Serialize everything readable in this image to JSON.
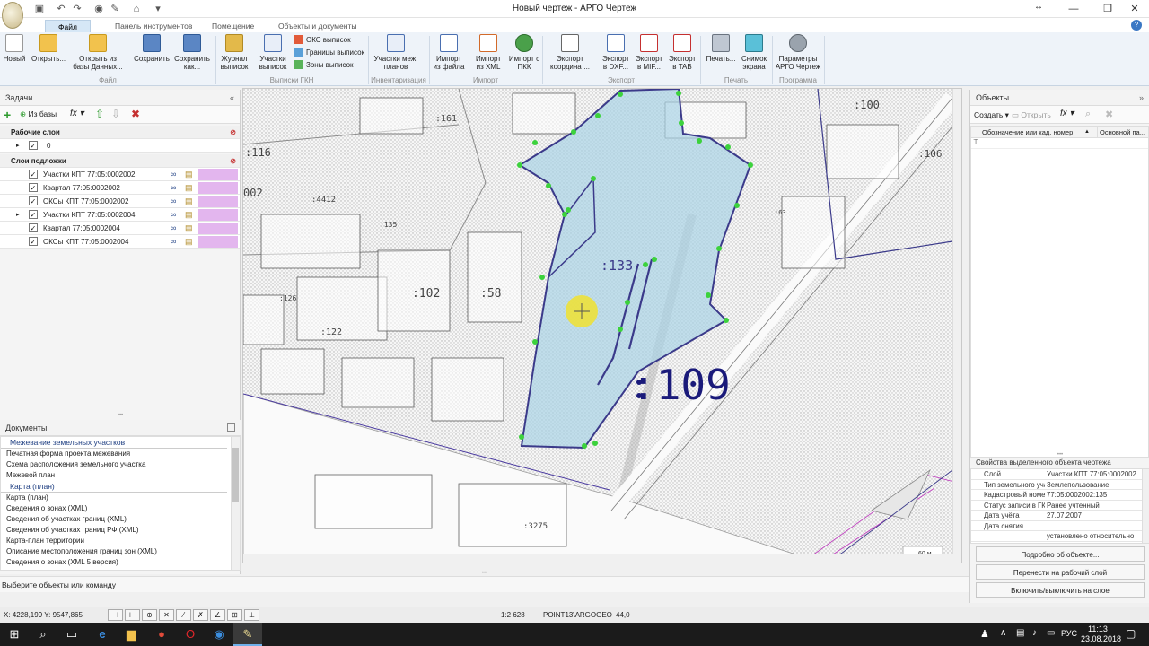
{
  "window": {
    "title": "Новый чертеж - АРГО Чертеж",
    "controls": [
      "—",
      "❐",
      "✕"
    ]
  },
  "tabs": [
    "Файл",
    "Панель инструментов",
    "Помещение",
    "Объекты и документы"
  ],
  "ribbon": {
    "buttons": {
      "new": "Новый",
      "open": "Открыть...",
      "open_db": "Открыть из базы Данных...",
      "save": "Сохранить",
      "save_as": "Сохранить как...",
      "journal": "Журнал выписок",
      "parcels": "Участки выписок",
      "oks": "ОКС выписок",
      "borders": "Границы выписок",
      "zones": "Зоны выписок",
      "inter_parcels": "Участки меж. планов",
      "import_file": "Импорт из файла",
      "import_xml": "Импорт из XML",
      "import_pkk": "Импорт с ПКК",
      "export_coords": "Экспорт координат...",
      "export_dxf": "Экспорт в DXF...",
      "export_mif": "Экспорт в MIF...",
      "export_tab": "Экспорт в TAB",
      "print": "Печать...",
      "snapshot": "Снимок экрана",
      "params": "Параметры АРГО Чертеж"
    },
    "groups": {
      "file": "Файл",
      "gkn": "Выписки ГКН",
      "inv": "Инвентаризация",
      "import": "Импорт",
      "export": "Экспорт",
      "print": "Печать",
      "program": "Программа"
    }
  },
  "tasks": {
    "title": "Задачи",
    "from_db": "Из базы",
    "fx": "fx",
    "working_layers": "Рабочие слои",
    "working_items": [
      "0"
    ],
    "base_layers": "Слои подложки",
    "base_items": [
      "Участки КПТ 77:05:0002002",
      "Квартал 77:05:0002002",
      "ОКСы КПТ 77:05:0002002",
      "Участки КПТ 77:05:0002004",
      "Квартал 77:05:0002004",
      "ОКСы КПТ 77:05:0002004"
    ]
  },
  "documents": {
    "title": "Документы",
    "section1": "Межевание земельных участков",
    "items1": [
      "Печатная форма проекта межевания",
      "Схема расположения земельного участка",
      "Межевой план"
    ],
    "section2": "Карта (план)",
    "items2": [
      "Карта (план)",
      "Сведения о зонах (XML)",
      "Сведения об участках границ (XML)",
      "Сведения об участках границ РФ (XML)",
      "Карта-план территории",
      "Описание местоположения границ зон (XML)",
      "Сведения о зонах (XML 5 версия)"
    ]
  },
  "map": {
    "labels": [
      ":161",
      ":116",
      "002",
      ":4412",
      ":135",
      ":126",
      ":102",
      ":58",
      ":122",
      ":133",
      ":63",
      ":109",
      ":3275",
      ":100",
      ":106"
    ],
    "scale": "60 м",
    "colors": {
      "selection": "#a9d3e6",
      "boundary": "#3b3a8a",
      "vertex": "#3cd23c",
      "hatch": "#bdbdbd",
      "cursor": "#f0e230"
    }
  },
  "objects": {
    "title": "Объекты",
    "create": "Создать",
    "open": "Открыть",
    "col1": "Обозначение или кад. номер",
    "col2": "Основной па..."
  },
  "properties": {
    "title": "Свойства выделенного объекта чертежа",
    "rows": [
      {
        "k": "Слой",
        "v": "Участки КПТ 77:05:0002002"
      },
      {
        "k": "Тип земельного уча",
        "v": "Землепользование"
      },
      {
        "k": "Кадастровый номер",
        "v": "77:05:0002002:135"
      },
      {
        "k": "Статус записи в ГК",
        "v": "Ранее учтенный"
      },
      {
        "k": "Дата учёта",
        "v": "27.07.2007"
      },
      {
        "k": "Дата снятия",
        "v": ""
      },
      {
        "k": "",
        "v": "установлено относительно ориентира"
      }
    ],
    "btn_details": "Подробно об объекте...",
    "btn_move": "Перенести на рабочий слой",
    "btn_toggle": "Включить/выключить на слое"
  },
  "command": "Выберите объекты или команду",
  "status": {
    "coords": "X: 4228,199 Y: 9547,865",
    "scale": "1:2 628",
    "snap": "POINT13\\ARGOGEO",
    "angle": "44,0"
  },
  "taskbar": {
    "lang": "РУС",
    "time": "11:13",
    "date": "23.08.2018"
  }
}
